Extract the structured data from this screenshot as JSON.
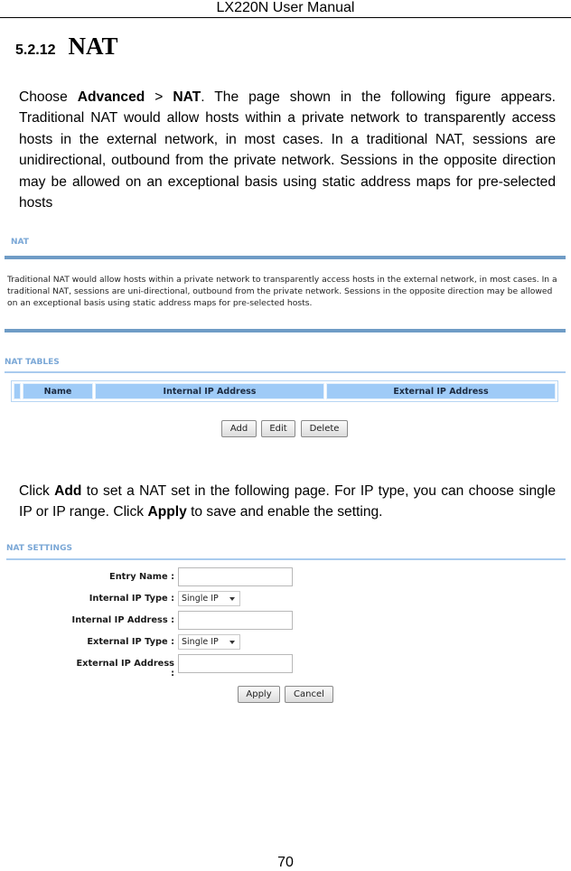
{
  "header": {
    "title": "LX220N User Manual"
  },
  "section": {
    "number": "5.2.12",
    "title": "NAT"
  },
  "intro": {
    "prefix": "Choose ",
    "bold1": "Advanced",
    "sep": " > ",
    "bold2": "NAT",
    "rest": ". The page shown in the following figure appears. Traditional NAT would allow hosts within a private network to transparently access hosts in the external network, in most cases. In a traditional NAT, sessions are unidirectional, outbound from the private network. Sessions in the opposite direction may be allowed on an exceptional basis using static address maps for pre-selected hosts"
  },
  "nat_panel": {
    "title": "NAT",
    "description": "Traditional NAT would allow hosts within a private network to transparently access hosts in the external network, in most cases. In a traditional NAT, sessions are uni-directional, outbound from the private network. Sessions in the opposite direction may be allowed on an exceptional basis using static address maps for pre-selected hosts."
  },
  "nat_tables": {
    "title": "NAT TABLES",
    "columns": [
      "Name",
      "Internal IP Address",
      "External IP Address"
    ],
    "buttons": {
      "add": "Add",
      "edit": "Edit",
      "delete": "Delete"
    }
  },
  "instructions": {
    "p1": "Click ",
    "b1": "Add",
    "p2": " to set a NAT set in the following page. For IP type, you can choose single IP or IP range. Click ",
    "b2": "Apply",
    "p3": " to save and enable the setting."
  },
  "nat_settings": {
    "title": "NAT SETTINGS",
    "fields": {
      "entry_name": {
        "label": "Entry Name :",
        "value": ""
      },
      "internal_ip_type": {
        "label": "Internal IP Type :",
        "value": "Single IP"
      },
      "internal_ip_address": {
        "label": "Internal IP Address :",
        "value": ""
      },
      "external_ip_type": {
        "label": "External IP Type :",
        "value": "Single IP"
      },
      "external_ip_address": {
        "label": "External IP Address :",
        "value": ""
      }
    },
    "buttons": {
      "apply": "Apply",
      "cancel": "Cancel"
    }
  },
  "footer": {
    "page_number": "70"
  }
}
